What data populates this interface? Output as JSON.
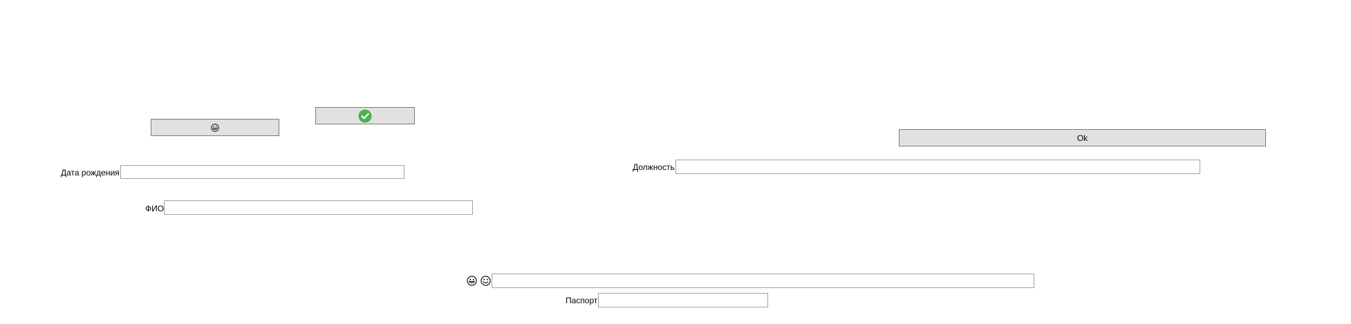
{
  "form": {
    "ok_button_label": "Ok",
    "birth_date_label": "Дата рождения",
    "birth_date_value": "",
    "full_name_label": "ФИО",
    "full_name_value": "",
    "position_label": "Должность",
    "position_value": "",
    "passport_label": "Паспорт",
    "passport_value": "",
    "emoji_field_value": ""
  },
  "icons": {
    "smiley_button_icon": "grinning-face-icon",
    "check_button_icon": "green-checkmark-icon",
    "emoji_row_icons": [
      "grinning-face-icon",
      "smiling-face-icon"
    ]
  },
  "colors": {
    "button_bg": "#e1e1e1",
    "button_border": "#7a7a7a",
    "field_border": "#a0a0a0",
    "check_green": "#4caf50"
  }
}
